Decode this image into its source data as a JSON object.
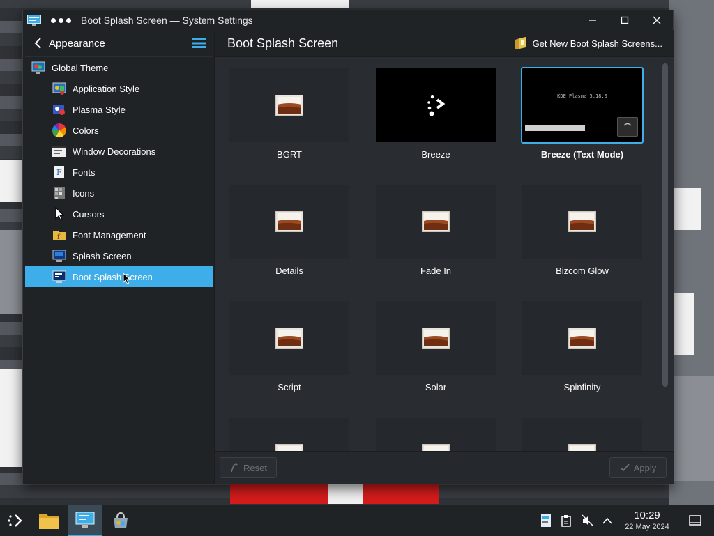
{
  "window": {
    "title": "Boot Splash Screen — System Settings"
  },
  "sidebar": {
    "title": "Appearance",
    "items": [
      {
        "label": "Global Theme",
        "level": 0
      },
      {
        "label": "Application Style",
        "level": 1
      },
      {
        "label": "Plasma Style",
        "level": 1
      },
      {
        "label": "Colors",
        "level": 1
      },
      {
        "label": "Window Decorations",
        "level": 1
      },
      {
        "label": "Fonts",
        "level": 1
      },
      {
        "label": "Icons",
        "level": 1
      },
      {
        "label": "Cursors",
        "level": 1
      },
      {
        "label": "Font Management",
        "level": 1
      },
      {
        "label": "Splash Screen",
        "level": 1
      },
      {
        "label": "Boot Splash Screen",
        "level": 1,
        "active": true
      }
    ]
  },
  "main": {
    "title": "Boot Splash Screen",
    "get_new_label": "Get New Boot Splash Screens...",
    "themes": [
      {
        "name": "BGRT"
      },
      {
        "name": "Breeze"
      },
      {
        "name": "Breeze (Text Mode)",
        "selected": true,
        "preview_text": "KDE Plasma 5.18.0"
      },
      {
        "name": "Details"
      },
      {
        "name": "Fade In"
      },
      {
        "name": "Bizcom Glow"
      },
      {
        "name": "Script"
      },
      {
        "name": "Solar"
      },
      {
        "name": "Spinfinity"
      }
    ],
    "reset_label": "Reset",
    "apply_label": "Apply"
  },
  "taskbar": {
    "time": "10:29",
    "date": "22 May 2024"
  },
  "colors": {
    "accent": "#3daee9",
    "window_bg": "#202326",
    "content_bg": "#292c30"
  }
}
